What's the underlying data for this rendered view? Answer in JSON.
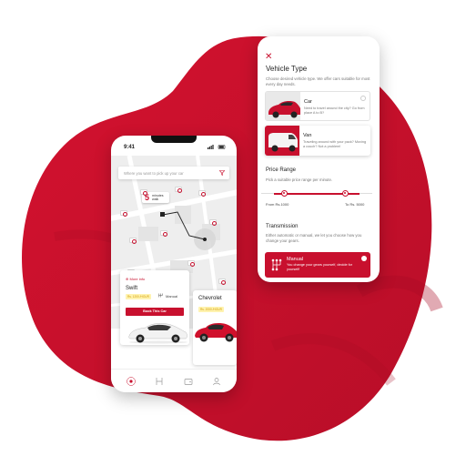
{
  "colors": {
    "brand_red": "#c8102e",
    "blob_red": "#c8102e",
    "badge_bg": "#fff3b0"
  },
  "left_phone": {
    "status_time": "9:41",
    "search": {
      "placeholder": "Where you want to pick up your car",
      "icon": "filter-funnel-icon"
    },
    "eta": {
      "value": "5",
      "unit": "minutes walk"
    },
    "cards": [
      {
        "more_info": "More info",
        "name": "Swift",
        "price": "Rs. 1200 /HOUR",
        "transmission": "Manual",
        "button": "Book This Car"
      },
      {
        "name": "Chevrolet",
        "price": "Rs. 2000 /HOUR"
      }
    ],
    "nav_icons": [
      "map-pin-icon",
      "route-icon",
      "wallet-icon",
      "profile-icon"
    ]
  },
  "right_phone": {
    "close_icon": "close-icon",
    "title": "Vehicle Type",
    "description": "Choose desired vehicle type. We offer cars suitable for most every day needs.",
    "options": [
      {
        "name": "Car",
        "description": "Need to travel around the city? Go from place A to B?"
      },
      {
        "name": "Van",
        "description": "Traveling around with your pack? Moving a couch? Not a problem!"
      }
    ],
    "price_range": {
      "title": "Price Range",
      "description": "Pick a suitable price range per minute.",
      "from_label": "From Rs.1000",
      "to_label": "To Rs. 5000"
    },
    "transmission": {
      "title": "Transmission",
      "description": "Either automatic or manual, we let you choose how you change your gears.",
      "option": {
        "name": "Manual",
        "description": "You change your gears yourself, decide for yourself!"
      }
    }
  }
}
